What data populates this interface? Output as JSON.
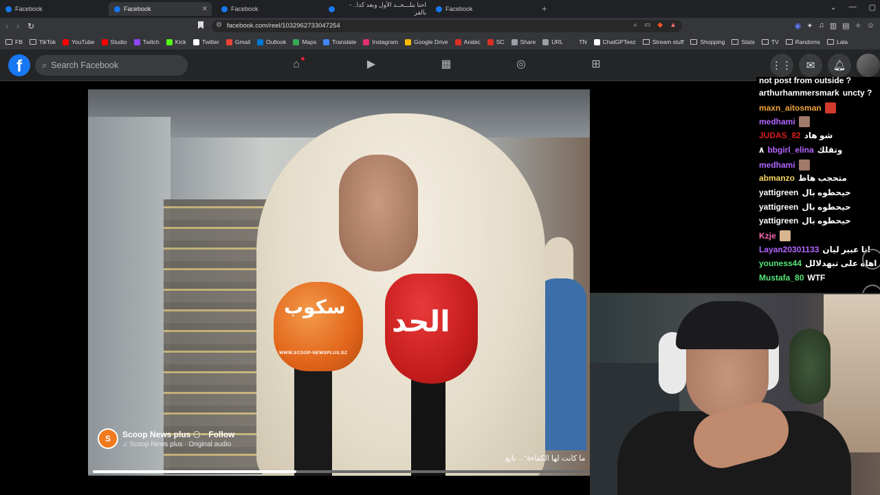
{
  "browser": {
    "tabs": [
      {
        "title": "Facebook",
        "active": false
      },
      {
        "title": "Facebook",
        "active": true
      },
      {
        "title": "Facebook",
        "active": false
      },
      {
        "title": "احنا بنلـــحــد الأول وبعد كدا.. - بالفر",
        "active": false
      },
      {
        "title": "Facebook",
        "active": false
      }
    ],
    "url": "facebook.com/reel/1032962733047254",
    "bookmarks": [
      {
        "label": "FB",
        "type": "folder"
      },
      {
        "label": "TikTok",
        "type": "folder"
      },
      {
        "label": "YouTube",
        "color": "#ff0000"
      },
      {
        "label": "Studio",
        "color": "#ff0000"
      },
      {
        "label": "Twitch",
        "color": "#9146ff"
      },
      {
        "label": "Kick",
        "color": "#53fc18"
      },
      {
        "label": "Twitter",
        "color": "#ffffff"
      },
      {
        "label": "Gmail",
        "color": "#ea4335"
      },
      {
        "label": "Outlook",
        "color": "#0078d4"
      },
      {
        "label": "Maps",
        "color": "#34a853"
      },
      {
        "label": "Translate",
        "color": "#4285f4"
      },
      {
        "label": "Instagram",
        "color": "#e1306c"
      },
      {
        "label": "Google Drive",
        "color": "#fbbc04"
      },
      {
        "label": "Arabic",
        "color": "#d93025"
      },
      {
        "label": "SC",
        "color": "#d93025"
      },
      {
        "label": "Share",
        "color": "#9aa0a6"
      },
      {
        "label": "URL",
        "color": "#9aa0a6"
      },
      {
        "label": "TN",
        "color": "#35363a"
      },
      {
        "label": "ChatGPTeez",
        "color": "#ffffff"
      },
      {
        "label": "Stream stuff",
        "type": "folder"
      },
      {
        "label": "Shopping",
        "type": "folder"
      },
      {
        "label": "Stats",
        "type": "folder"
      },
      {
        "label": "TV",
        "type": "folder"
      },
      {
        "label": "Randoms",
        "type": "folder"
      },
      {
        "label": "Lala",
        "type": "folder"
      }
    ]
  },
  "facebook": {
    "search_placeholder": "Search Facebook",
    "brand_color": "#1877f2"
  },
  "reel": {
    "page_name": "Scoop News plus",
    "follow_label": "Follow",
    "audio": "Scoop News plus · Original audio",
    "caption": "ما كانت لها الكفاءة\"... تابع",
    "progress": 0.41,
    "mic_orange_text": "WWW.SCOOP-NEWSPLUS.DZ",
    "mic_red_text": "الحد"
  },
  "chat": {
    "top_partial": "not post from outside ?",
    "messages": [
      {
        "user": "arthurhammersmark",
        "color": "#ffffff",
        "msg": "uncty ?"
      },
      {
        "user": "maxn_aitosman",
        "color": "#f0a33b",
        "msg": "",
        "emote": "#d23a2e"
      },
      {
        "user": "medhami",
        "color": "#b266ff",
        "msg": "",
        "emote": "#a07a6a"
      },
      {
        "user": "JUDAS_82",
        "color": "#d91c1c",
        "msg": "شو هاد"
      },
      {
        "user": "bbgirl_elina",
        "color": "#b266ff",
        "msg": "وتقلك",
        "prefix": "٨"
      },
      {
        "user": "medhami",
        "color": "#b266ff",
        "msg": "",
        "emote": "#a07a6a"
      },
      {
        "user": "abmanzo",
        "color": "#f5d45e",
        "msg": "متحجب هاظ"
      },
      {
        "user": "yattigreen",
        "color": "#ffffff",
        "msg": "حيحطوه بال"
      },
      {
        "user": "yattigreen",
        "color": "#ffffff",
        "msg": "حيحطوه بال"
      },
      {
        "user": "yattigreen",
        "color": "#ffffff",
        "msg": "حيحطوه بال"
      },
      {
        "user": "Kzje",
        "color": "#ff6ab0",
        "msg": "",
        "emote": "#d8b48f"
      },
      {
        "user": "Layan20301133",
        "color": "#b266ff",
        "msg": "انا عبير ليان"
      },
      {
        "user": "youness44",
        "color": "#54e67a",
        "msg": "اهاه على تبهدلالل"
      },
      {
        "user": "Mustafa_80",
        "color": "#54e67a",
        "msg": "WTF"
      }
    ]
  }
}
